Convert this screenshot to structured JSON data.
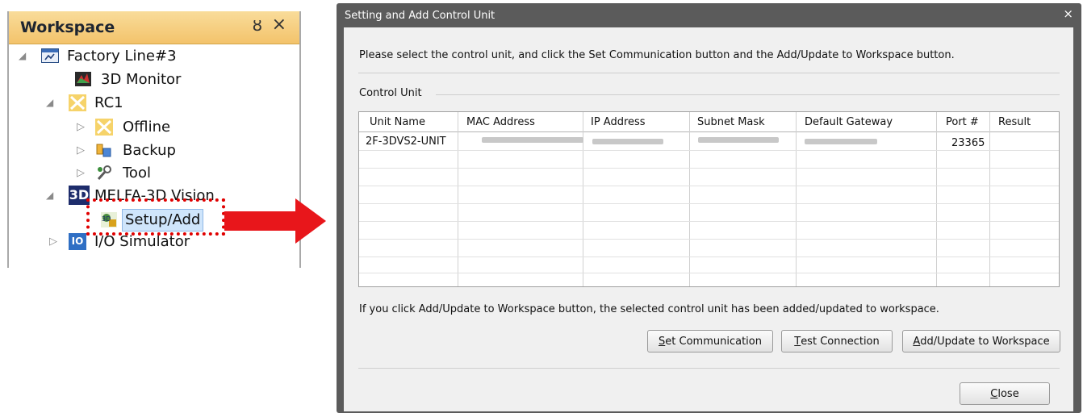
{
  "workspace": {
    "title": "Workspace",
    "pin_glyph": "ȣ",
    "close_glyph": "×",
    "tree": [
      {
        "label": "Factory Line#3",
        "icon": "factory-line-icon",
        "expanded": true
      },
      {
        "label": "3D Monitor",
        "icon": "3d-monitor-icon"
      },
      {
        "label": "RC1",
        "icon": "robot-controller-icon",
        "expanded": true
      },
      {
        "label": "Offline",
        "icon": "offline-icon",
        "expanded": false
      },
      {
        "label": "Backup",
        "icon": "backup-icon",
        "expanded": false
      },
      {
        "label": "Tool",
        "icon": "tool-icon",
        "expanded": false
      },
      {
        "label": "MELFA-3D Vision",
        "icon": "3d-vision-icon",
        "icon_text": "3D",
        "expanded": true
      },
      {
        "label": "Setup/Add",
        "icon": "setup-add-icon",
        "selected": true
      },
      {
        "label": "I/O Simulator",
        "icon": "io-simulator-icon",
        "icon_text": "IO",
        "expanded": false
      }
    ]
  },
  "dialog": {
    "title": "Setting and Add Control Unit",
    "close_glyph": "×",
    "instruction": "Please select the control unit, and click the Set Communication button and the Add/Update to Workspace button.",
    "group_label": "Control Unit",
    "columns": [
      "Unit Name",
      "MAC Address",
      "IP Address",
      "Subnet Mask",
      "Default Gateway",
      "Port #",
      "Result"
    ],
    "rows": [
      {
        "unit_name": "2F-3DVS2-UNIT",
        "mac": "",
        "ip": "",
        "subnet": "",
        "gateway": "",
        "port": "23365",
        "result": ""
      }
    ],
    "note": "If you click Add/Update to Workspace button, the selected control unit has been added/updated to workspace.",
    "buttons": {
      "set_communication": {
        "mnemonic": "S",
        "rest": "et Communication"
      },
      "test_connection": {
        "mnemonic": "T",
        "rest": "est Connection"
      },
      "add_update": {
        "mnemonic": "A",
        "rest": "dd/Update to Workspace"
      },
      "close": {
        "mnemonic": "C",
        "rest": "lose"
      }
    }
  },
  "colors": {
    "highlight": "#e00000",
    "arrow": "#e8161b",
    "panel_header": "#f3c36b",
    "dialog_frame": "#5b5b5b"
  }
}
